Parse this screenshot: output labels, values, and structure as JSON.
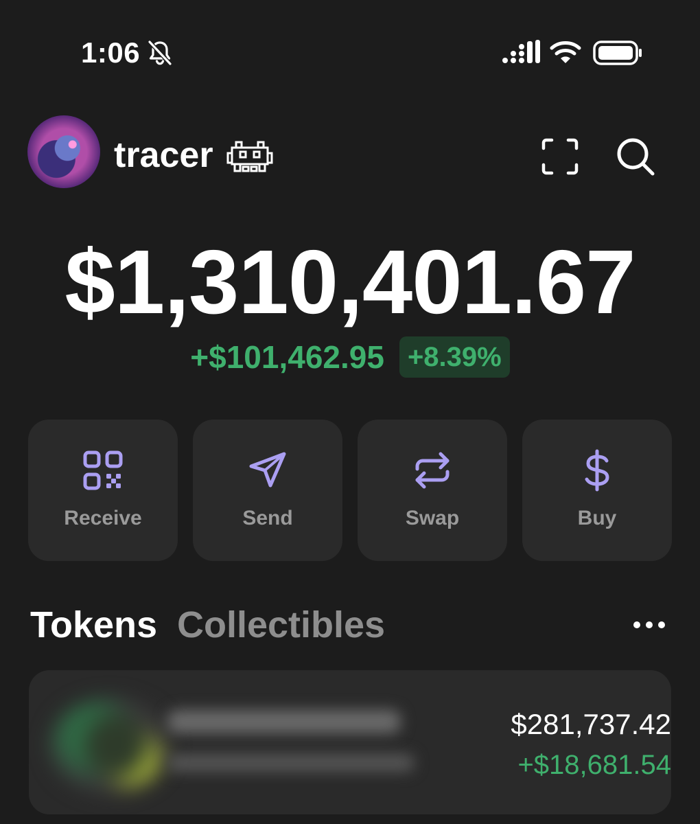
{
  "status_bar": {
    "time": "1:06",
    "icons": [
      "bell-slash-icon",
      "signal-icon",
      "wifi-icon",
      "battery-icon"
    ]
  },
  "header": {
    "username": "tracer",
    "icons": [
      "avatar",
      "space-invader-icon",
      "scan-icon",
      "search-icon"
    ]
  },
  "balance": {
    "total": "$1,310,401.67",
    "change_amount": "+$101,462.95",
    "change_percent": "+8.39%"
  },
  "actions": [
    {
      "label": "Receive",
      "icon": "qr-code-icon"
    },
    {
      "label": "Send",
      "icon": "send-icon"
    },
    {
      "label": "Swap",
      "icon": "swap-icon"
    },
    {
      "label": "Buy",
      "icon": "dollar-icon"
    }
  ],
  "tabs": {
    "tokens": "Tokens",
    "collectibles": "Collectibles",
    "active": "Tokens"
  },
  "tokens": [
    {
      "value": "$281,737.42",
      "change": "+$18,681.54",
      "name_blurred": true
    }
  ],
  "colors": {
    "background": "#1c1c1c",
    "card": "#2a2a2a",
    "accent": "#ab9ff2",
    "positive": "#3fb06d",
    "positive_pill": "#1f3d2a",
    "muted_text": "#9a9a9a"
  }
}
